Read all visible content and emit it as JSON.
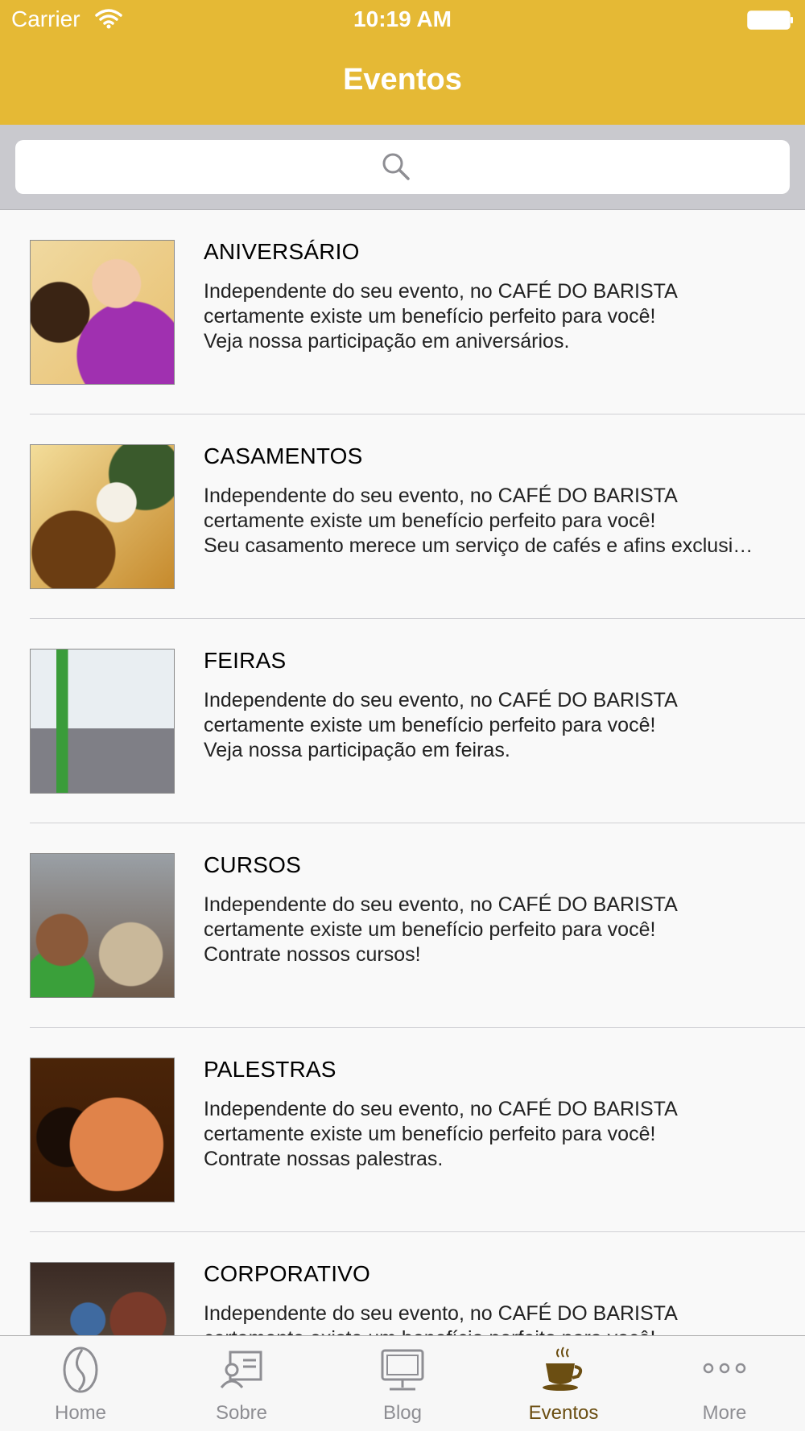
{
  "status_bar": {
    "carrier": "Carrier",
    "time": "10:19 AM"
  },
  "nav": {
    "title": "Eventos"
  },
  "search": {
    "placeholder": ""
  },
  "events": [
    {
      "title": "ANIVERSÁRIO",
      "lines": [
        "Independente do seu evento, no CAFÉ DO BARISTA",
        "certamente existe um benefício perfeito para você!",
        "Veja nossa participação em aniversários."
      ]
    },
    {
      "title": "CASAMENTOS",
      "lines": [
        "Independente do seu evento, no CAFÉ DO BARISTA",
        "certamente existe um benefício perfeito para você!",
        "Seu casamento merece um serviço de cafés e afins exclusi…"
      ]
    },
    {
      "title": "FEIRAS",
      "lines": [
        "Independente do seu evento, no CAFÉ DO BARISTA",
        "certamente existe um benefício perfeito para você!",
        "Veja nossa participação em feiras."
      ]
    },
    {
      "title": "CURSOS",
      "lines": [
        "Independente do seu evento, no CAFÉ DO BARISTA",
        "certamente existe um benefício perfeito para você!",
        "Contrate nossos cursos!"
      ]
    },
    {
      "title": "PALESTRAS",
      "lines": [
        "Independente do seu evento, no CAFÉ DO BARISTA",
        "certamente existe um benefício perfeito para você!",
        "Contrate nossas palestras."
      ]
    },
    {
      "title": "CORPORATIVO",
      "lines": [
        "Independente do seu evento, no CAFÉ DO BARISTA",
        "certamente existe um benefício perfeito para você!",
        ""
      ]
    }
  ],
  "tabbar": {
    "items": [
      {
        "label": "Home",
        "icon": "coffee-bean-icon"
      },
      {
        "label": "Sobre",
        "icon": "profile-card-icon"
      },
      {
        "label": "Blog",
        "icon": "computer-icon"
      },
      {
        "label": "Eventos",
        "icon": "coffee-cup-icon",
        "active": true
      },
      {
        "label": "More",
        "icon": "more-dots-icon"
      }
    ],
    "active_color": "#6b4e12",
    "inactive_color": "#8e8e93"
  },
  "colors": {
    "brand": "#e5b935"
  }
}
